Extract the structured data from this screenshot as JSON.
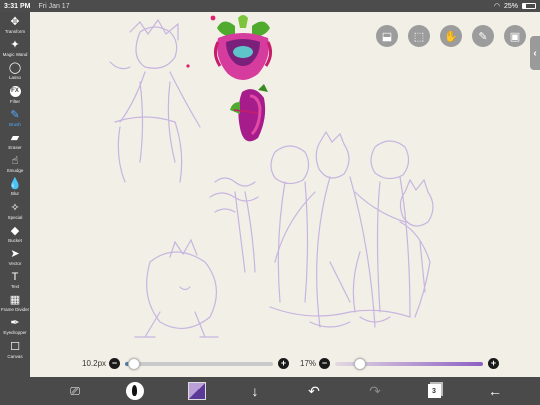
{
  "status": {
    "time": "3:31 PM",
    "date": "Fri Jan 17",
    "battery": "25%"
  },
  "tools": [
    {
      "name": "transform",
      "label": "Transform",
      "glyph": "✥",
      "active": false
    },
    {
      "name": "magic-wand",
      "label": "Magic Wand",
      "glyph": "✦",
      "active": false
    },
    {
      "name": "lasso",
      "label": "Lasso",
      "glyph": "◯",
      "active": false
    },
    {
      "name": "filter",
      "label": "Filter",
      "glyph": "FX",
      "active": false
    },
    {
      "name": "brush",
      "label": "Brush",
      "glyph": "✎",
      "active": true
    },
    {
      "name": "eraser",
      "label": "Eraser",
      "glyph": "▰",
      "active": false
    },
    {
      "name": "smudge",
      "label": "Smudge",
      "glyph": "☝",
      "active": false
    },
    {
      "name": "blur",
      "label": "Blur",
      "glyph": "💧",
      "active": false
    },
    {
      "name": "special",
      "label": "Special",
      "glyph": "✧",
      "active": false
    },
    {
      "name": "bucket",
      "label": "Bucket",
      "glyph": "◆",
      "active": false
    },
    {
      "name": "vector",
      "label": "Vector",
      "glyph": "➤",
      "active": false
    },
    {
      "name": "text",
      "label": "Text",
      "glyph": "T",
      "active": false
    },
    {
      "name": "frame-divider",
      "label": "Frame Divider",
      "glyph": "▦",
      "active": false
    },
    {
      "name": "eyedropper",
      "label": "Eyedropper",
      "glyph": "✒",
      "active": false
    },
    {
      "name": "canvas",
      "label": "Canvas",
      "glyph": "☐",
      "active": false
    }
  ],
  "brush_size": {
    "label": "10.2px",
    "fraction": 0.06
  },
  "opacity": {
    "label": "17%",
    "fraction": 0.17
  },
  "colors": {
    "toolbar": "#4a4a4a",
    "active": "#55aaff",
    "slider_track": "#5a7da8",
    "opacity_track": "#8d5fc4",
    "paper": "#f2efe7"
  },
  "layers_count": "3"
}
